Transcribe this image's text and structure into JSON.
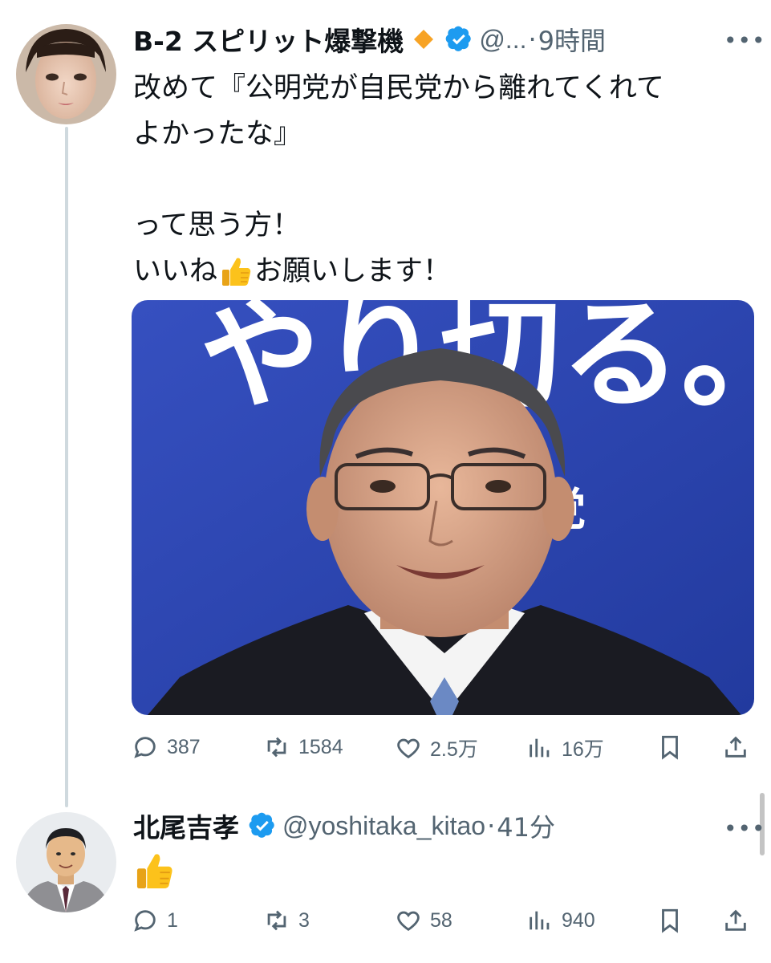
{
  "tweet": {
    "display_name": "B-2 スピリット爆撃機",
    "handle": "@...",
    "separator": "·",
    "time": "9時間",
    "more": "•••",
    "text_lines": [
      "改めて『公明党が自民党から離れてくれて",
      "よかったな』",
      "",
      "って思う方！",
      "いいね"
    ],
    "text_after_emoji": "お願いします！",
    "inline_emoji": "thumbs-up-icon",
    "image_text": {
      "line1": "やり切る。",
      "line2": "党"
    },
    "stats": {
      "replies": "387",
      "retweets": "1584",
      "likes": "2.5万",
      "views": "16万"
    }
  },
  "reply": {
    "display_name": "北尾吉孝",
    "handle": "@yoshitaka_kitao",
    "separator": "·",
    "time": "41分",
    "more": "•••",
    "content_emoji": "thumbs-up-icon",
    "stats": {
      "replies": "1",
      "retweets": "3",
      "likes": "58",
      "views": "940"
    }
  },
  "colors": {
    "verified": "#1d9bf0",
    "diamond": "#f7a325",
    "muted": "#536471",
    "image_bg": "#2a40a8"
  }
}
